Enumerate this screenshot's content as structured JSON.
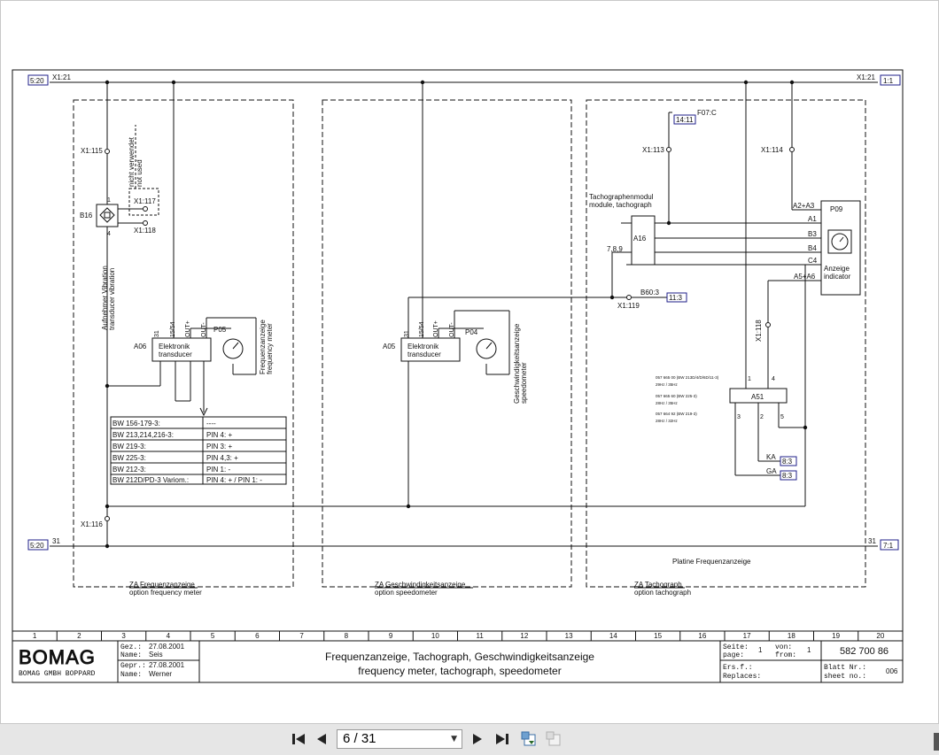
{
  "colors": {
    "line": "#111111",
    "xref_box": "#1f1f8a",
    "sheet_bg": "#ffffff",
    "viewer_bg": "#e6e6e6"
  },
  "xrefs": {
    "left_top": "5:20",
    "left_top_label": "X1:21",
    "right_top": "1:1",
    "right_top_label": "X1:21",
    "left_bottom": "5:20",
    "left_bottom_label": "31",
    "right_bottom": "7:1",
    "right_bottom_label": "31",
    "f07_box": "14:11",
    "f07_label": "F07:C",
    "b60_box": "11:3",
    "b60_label": "B60:3",
    "ka_box": "8:3",
    "ga_box": "8:3"
  },
  "group_freq": {
    "x1_115": "X1:115",
    "not_used_de": "nicht verwendet",
    "not_used_en": "not used",
    "x1_117": "X1:117",
    "x1_118": "X1:118",
    "b16": "B16",
    "pin1": "1",
    "pin4": "4",
    "sensor_de": "Aufnehmer Vibration",
    "sensor_en": "transducer vibration",
    "a06": "A06",
    "elektronik": "Elektronik",
    "transducer": "transducer",
    "pin_15": "15/54",
    "pin_out_plus": "OUT+",
    "pin_out_minus": "OUT-",
    "pin_31": "31",
    "p05": "P05",
    "meter_de": "Frequenzanzeige",
    "meter_en": "frequency meter",
    "x1_116": "X1:116",
    "footer_de": "ZA Frequenzanzeige",
    "footer_en": "option frequency meter",
    "variant_table": [
      [
        "BW 156-179-3:",
        "----"
      ],
      [
        "BW 213,214,216-3:",
        "PIN 4: +"
      ],
      [
        "BW 219-3:",
        "PIN 3: +"
      ],
      [
        "BW 225-3:",
        "PIN 4,3: +"
      ],
      [
        "BW 212-3:",
        "PIN 1: -"
      ],
      [
        "BW 212D/PD-3 Variom.:",
        "PIN 4: + / PIN 1: -"
      ]
    ]
  },
  "group_speed": {
    "a05": "A05",
    "elektronik": "Elektronik",
    "transducer": "transducer",
    "pin_15": "15/54",
    "pin_out_plus": "OUT+",
    "pin_out_minus": "OUT-",
    "pin_31": "31",
    "p04": "P04",
    "meter_de": "Geschwindigkeitsanzeige",
    "meter_en": "speedometer",
    "footer_de": "ZA Geschwindigkeitsanzeige",
    "footer_en": "option speedometer"
  },
  "group_tacho": {
    "x1_113": "X1:113",
    "x1_114": "X1:114",
    "module_de": "Tachographenmodul",
    "module_en": "module, tachograph",
    "a16": "A16",
    "pin_789": "7,8,9",
    "x1_119": "X1:119",
    "p09": "P09",
    "a2a3": "A2+A3",
    "a1": "A1",
    "b3": "B3",
    "b4": "B4",
    "c4": "C4",
    "a5a6": "A5+A6",
    "anzeige": "Anzeige",
    "indicator": "indicator",
    "x1_118": "X1:118",
    "a51": "A51",
    "note1": "057 665 00 (BW 213D/4/D/6D/11-3)",
    "note1b": "29Hz / 35Hz",
    "note2": "057 665 60 (BW 225-3)",
    "note2b": "28Hz / 35Hz",
    "note3": "057 664 92 (BW 219-3)",
    "note3b": "28Hz / 32Hz",
    "ka": "KA",
    "ga": "GA",
    "platine": "Platine Frequenzanzeige",
    "footer_de": "ZA Tachograph",
    "footer_en": "option tachograph"
  },
  "column_numbers": [
    "1",
    "2",
    "3",
    "4",
    "5",
    "6",
    "7",
    "8",
    "9",
    "10",
    "11",
    "12",
    "13",
    "14",
    "15",
    "16",
    "17",
    "18",
    "19",
    "20"
  ],
  "title_block": {
    "logo": "BOMAG",
    "company": "BOMAG GMBH BOPPARD",
    "gez_label": "Gez.:",
    "gez_date": "27.08.2001",
    "name1_label": "Name:",
    "name1": "Seis",
    "gepr_label": "Gepr.:",
    "gepr_date": "27.08.2001",
    "name2_label": "Name:",
    "name2": "Werner",
    "title_de": "Frequenzanzeige, Tachograph, Geschwindigkeitsanzeige",
    "title_en": "frequency meter, tachograph, speedometer",
    "seite_label": "Seite:",
    "page_label": "page:",
    "seite": "1",
    "von_label": "von:",
    "from_label": "from:",
    "von": "1",
    "drawing_no": "582 700 86",
    "ersf_label": "Ers.f.:",
    "replaces_label": "Replaces:",
    "blatt_label": "Blatt Nr.:",
    "sheet_label": "sheet no.:",
    "blatt": "006"
  },
  "toolbar": {
    "page_value": "6 / 31"
  }
}
